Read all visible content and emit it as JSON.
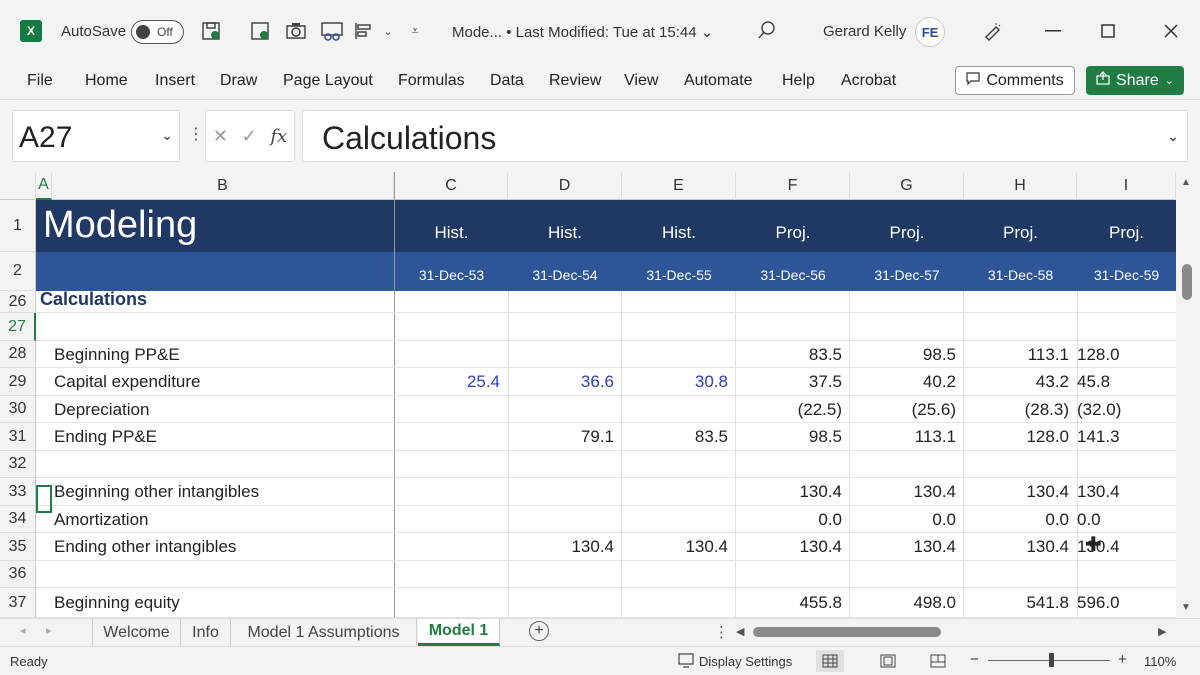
{
  "titlebar": {
    "app_logo": "X",
    "autosave_label": "AutoSave",
    "autosave_state": "Off",
    "doc_title": "Mode...  •  Last Modified: Tue at 15:44 ⌄",
    "user_name": "Gerard Kelly",
    "avatar_initials": "FE"
  },
  "ribbon": {
    "tabs": [
      "File",
      "Home",
      "Insert",
      "Draw",
      "Page Layout",
      "Formulas",
      "Data",
      "Review",
      "View",
      "Automate",
      "Help",
      "Acrobat"
    ],
    "comments_label": "Comments",
    "share_label": "Share"
  },
  "formula_bar": {
    "name_box": "A27",
    "formula": "Calculations",
    "fx_label": "fx"
  },
  "sheet": {
    "columns": [
      "A",
      "B",
      "C",
      "D",
      "E",
      "F",
      "G",
      "H",
      "I"
    ],
    "header_row1": {
      "title": "Modeling",
      "labels": [
        "Hist.",
        "Hist.",
        "Hist.",
        "Proj.",
        "Proj.",
        "Proj.",
        "Proj."
      ]
    },
    "header_row2": {
      "dates": [
        "31-Dec-53",
        "31-Dec-54",
        "31-Dec-55",
        "31-Dec-56",
        "31-Dec-57",
        "31-Dec-58",
        "31-Dec-59"
      ]
    },
    "row_numbers": [
      "1",
      "2",
      "26",
      "27",
      "28",
      "29",
      "30",
      "31",
      "32",
      "33",
      "34",
      "35",
      "36",
      "37"
    ],
    "section_title": "Calculations",
    "rows": [
      {
        "num": "28",
        "label": "Beginning PP&E",
        "values": [
          "",
          "",
          "",
          "83.5",
          "98.5",
          "113.1",
          "128.0"
        ]
      },
      {
        "num": "29",
        "label": "Capital expenditure",
        "values": [
          "25.4",
          "36.6",
          "30.8",
          "37.5",
          "40.2",
          "43.2",
          "45.8"
        ]
      },
      {
        "num": "30",
        "label": "Depreciation",
        "values": [
          "",
          "",
          "",
          "(22.5)",
          "(25.6)",
          "(28.3)",
          "(32.0)"
        ]
      },
      {
        "num": "31",
        "label": "Ending PP&E",
        "values": [
          "",
          "79.1",
          "83.5",
          "98.5",
          "113.1",
          "128.0",
          "141.3"
        ]
      },
      {
        "num": "32",
        "label": "",
        "values": [
          "",
          "",
          "",
          "",
          "",
          "",
          ""
        ]
      },
      {
        "num": "33",
        "label": "Beginning other intangibles",
        "values": [
          "",
          "",
          "",
          "130.4",
          "130.4",
          "130.4",
          "130.4"
        ]
      },
      {
        "num": "34",
        "label": "Amortization",
        "values": [
          "",
          "",
          "",
          "0.0",
          "0.0",
          "0.0",
          "0.0"
        ]
      },
      {
        "num": "35",
        "label": "Ending other intangibles",
        "values": [
          "",
          "130.4",
          "130.4",
          "130.4",
          "130.4",
          "130.4",
          "130.4"
        ]
      },
      {
        "num": "36",
        "label": "",
        "values": [
          "",
          "",
          "",
          "",
          "",
          "",
          ""
        ]
      },
      {
        "num": "37",
        "label": "Beginning equity",
        "values": [
          "",
          "",
          "",
          "455.8",
          "498.0",
          "541.8",
          "596.0"
        ]
      }
    ]
  },
  "tabs": {
    "sheets": [
      "Welcome",
      "Info",
      "Model 1 Assumptions",
      "Model 1"
    ],
    "active": "Model 1"
  },
  "status": {
    "ready": "Ready",
    "display_settings": "Display Settings",
    "zoom": "110%",
    "zoom_minus": "−",
    "zoom_plus": "+"
  },
  "colors": {
    "header_dark": "#1f3864",
    "header_mid": "#2e5597",
    "input_blue": "#2f3fbf",
    "excel_green": "#1f7d43"
  }
}
